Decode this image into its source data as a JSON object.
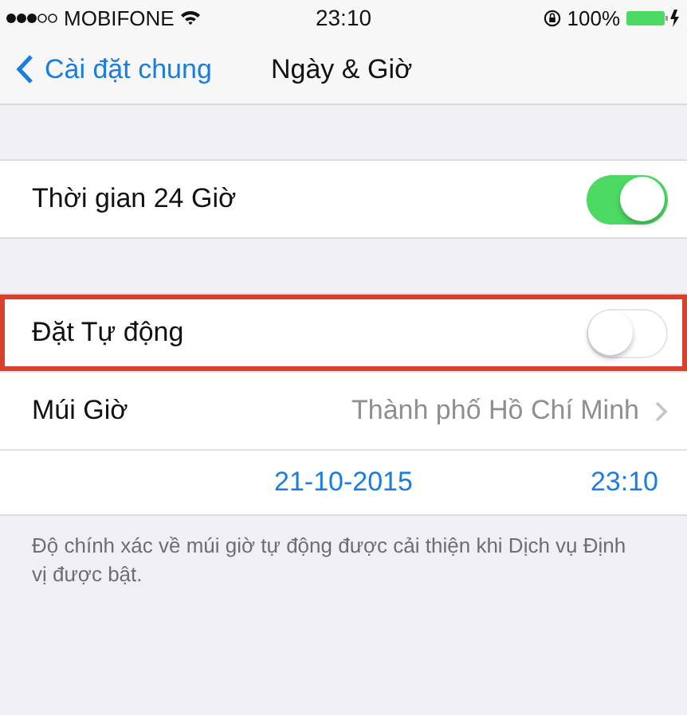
{
  "status_bar": {
    "carrier": "MOBIFONE",
    "time": "23:10",
    "battery": "100%"
  },
  "nav": {
    "back": "Cài đặt chung",
    "title": "Ngày & Giờ"
  },
  "groups": [
    {
      "rows": [
        {
          "kind": "toggle",
          "label": "Thời gian 24 Giờ",
          "on": true,
          "highlighted": false
        }
      ]
    },
    {
      "rows": [
        {
          "kind": "toggle",
          "label": "Đặt Tự động",
          "on": false,
          "highlighted": true
        },
        {
          "kind": "link",
          "label": "Múi Giờ",
          "value": "Thành phố Hồ Chí Minh"
        },
        {
          "kind": "datetime",
          "date": "21-10-2015",
          "time": "23:10"
        }
      ],
      "footer": "Độ chính xác về múi giờ tự động được cải thiện khi Dịch vụ Định vị được bật."
    }
  ]
}
